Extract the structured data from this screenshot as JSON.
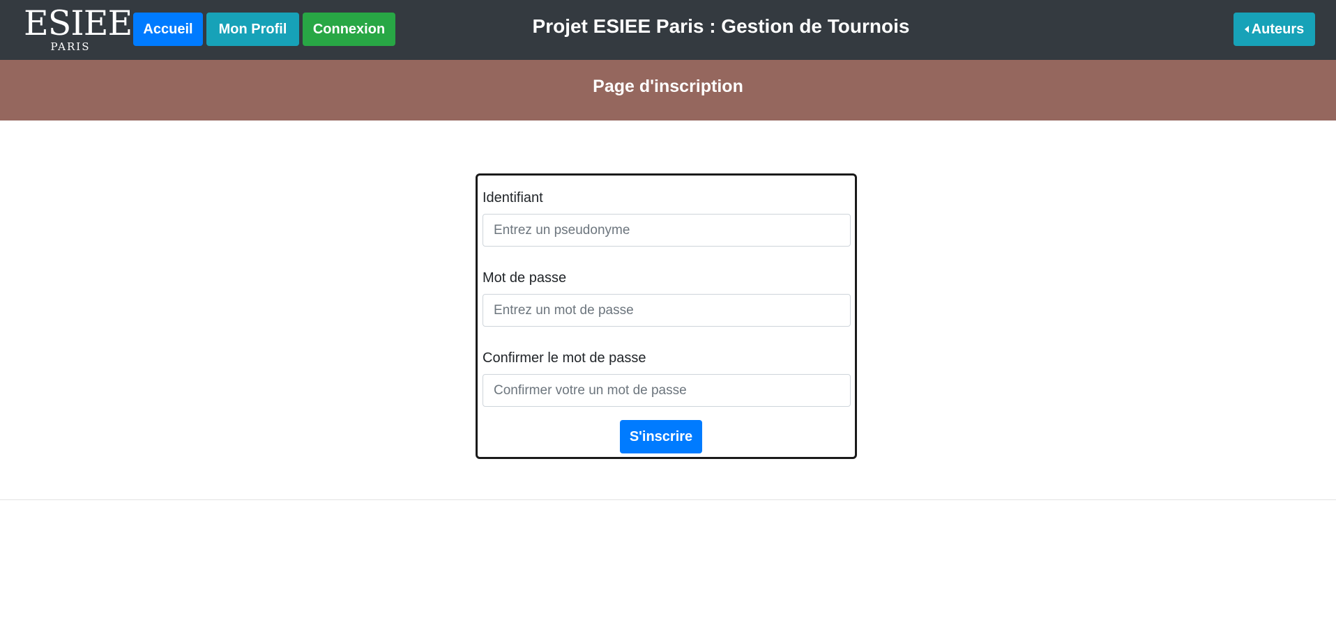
{
  "logo": {
    "main": "ESIEE",
    "sub": "PARIS"
  },
  "nav": {
    "accueil": "Accueil",
    "profil": "Mon Profil",
    "connexion": "Connexion",
    "auteurs": "Auteurs"
  },
  "header": {
    "title": "Projet ESIEE Paris : Gestion de Tournois"
  },
  "banner": {
    "title": "Page d'inscription"
  },
  "form": {
    "identifiant": {
      "label": "Identifiant",
      "placeholder": "Entrez un pseudonyme",
      "value": ""
    },
    "password": {
      "label": "Mot de passe",
      "placeholder": "Entrez un mot de passe",
      "value": ""
    },
    "confirm": {
      "label": "Confirmer le mot de passe",
      "placeholder": "Confirmer votre un mot de passe",
      "value": ""
    },
    "submit_label": "S'inscrire"
  },
  "colors": {
    "navbar": "#343a40",
    "banner": "#95675e",
    "primary": "#007bff",
    "info": "#17a2b8",
    "success": "#28a745"
  },
  "icons": {
    "auteurs": "caret-left-icon"
  }
}
